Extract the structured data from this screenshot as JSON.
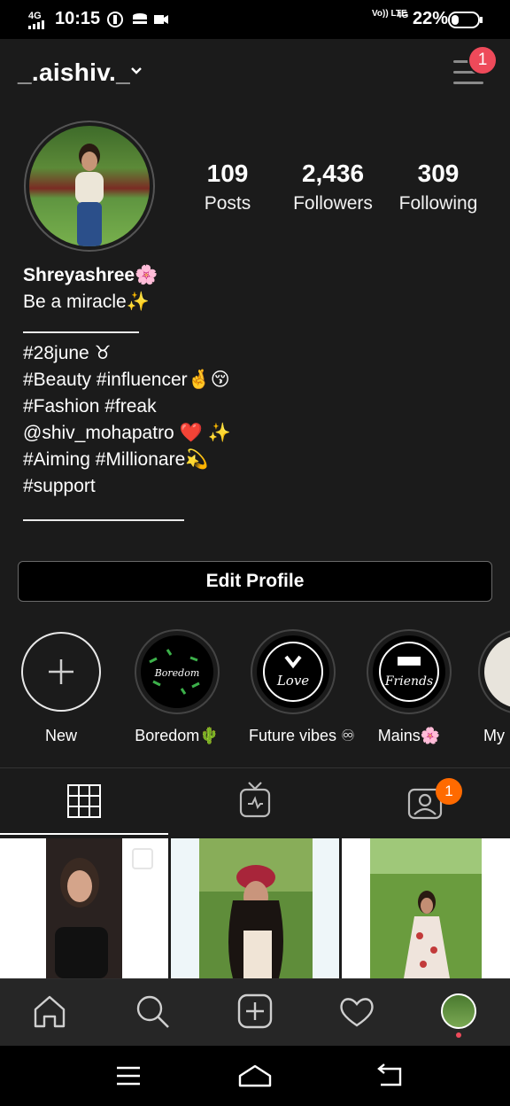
{
  "status_bar": {
    "signal": "4G",
    "time": "10:15",
    "volte": "Vo)) LTE",
    "network2": "4G",
    "battery": "22%"
  },
  "header": {
    "username": "_.aishiv._",
    "menu_badge": "1"
  },
  "profile": {
    "stats": [
      {
        "value": "109",
        "label": "Posts"
      },
      {
        "value": "2,436",
        "label": "Followers"
      },
      {
        "value": "309",
        "label": "Following"
      }
    ],
    "name": "Shreyashree🌸",
    "bio_lines": [
      "Be a miracle✨",
      "#28june ♉",
      "#Beauty #influencer🤞😚",
      "#Fashion #freak",
      "@shiv_mohapatro ❤️ ✨",
      "#Aiming #Millionare💫",
      "#support"
    ]
  },
  "edit_profile": "Edit Profile",
  "highlights": [
    {
      "label": "New"
    },
    {
      "label": "Boredom🌵",
      "text": "Boredom"
    },
    {
      "label": "Future vibes ♾",
      "text": "Love"
    },
    {
      "label": "Mains🌸",
      "text": "Friends"
    },
    {
      "label": "My"
    }
  ],
  "tabs": {
    "tagged_badge": "1",
    "icons": [
      "grid-icon",
      "igtv-icon",
      "tagged-icon"
    ]
  },
  "colors": {
    "background": "#1b1b1b",
    "badge_red": "#ee4a5a",
    "badge_orange": "#ff6a00"
  }
}
